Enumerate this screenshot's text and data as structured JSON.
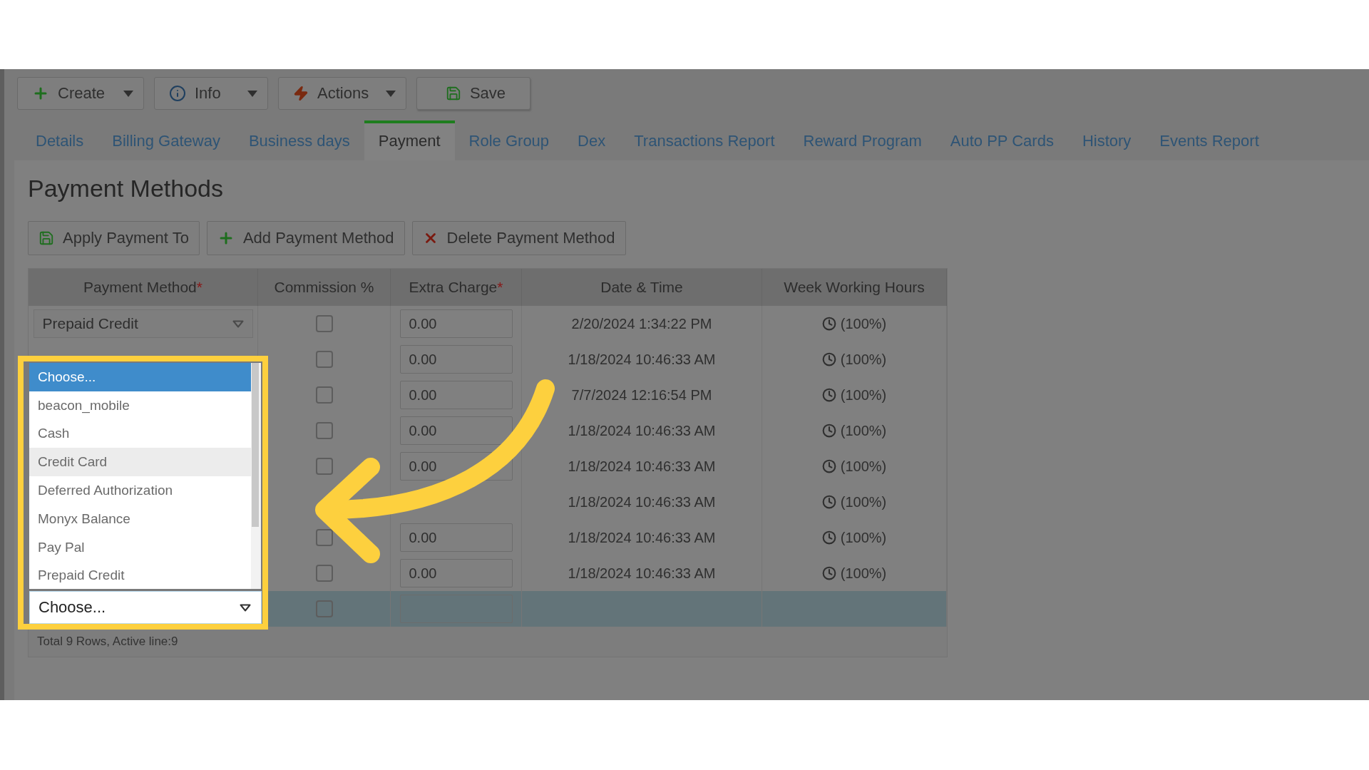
{
  "toolbar": [
    {
      "label": "Create",
      "kind": "create",
      "dropdown": true
    },
    {
      "label": "Info",
      "kind": "info",
      "dropdown": true
    },
    {
      "label": "Actions",
      "kind": "actions",
      "dropdown": true
    },
    {
      "label": "Save",
      "kind": "save",
      "dropdown": false
    }
  ],
  "tabs": [
    {
      "label": "Details",
      "selected": false
    },
    {
      "label": "Billing Gateway",
      "selected": false
    },
    {
      "label": "Business days",
      "selected": false
    },
    {
      "label": "Payment",
      "selected": true
    },
    {
      "label": "Role Group",
      "selected": false
    },
    {
      "label": "Dex",
      "selected": false
    },
    {
      "label": "Transactions Report",
      "selected": false
    },
    {
      "label": "Reward Program",
      "selected": false
    },
    {
      "label": "Auto PP Cards",
      "selected": false
    },
    {
      "label": "History",
      "selected": false
    },
    {
      "label": "Events Report",
      "selected": false
    }
  ],
  "title": "Payment Methods",
  "actions": [
    {
      "label": "Apply Payment To",
      "kind": "save"
    },
    {
      "label": "Add Payment Method",
      "kind": "add"
    },
    {
      "label": "Delete Payment Method",
      "kind": "delete"
    }
  ],
  "table": {
    "columns": [
      {
        "label": "Payment Method",
        "mark": "*"
      },
      {
        "label": "Commission %"
      },
      {
        "label": "Extra Charge",
        "mark": "*"
      },
      {
        "label": "Date & Time"
      },
      {
        "label": "Week Working Hours"
      }
    ],
    "rows": [
      {
        "payment_method": "Prepaid Credit",
        "checked": false,
        "extra_charge": "0.00",
        "date_time": "2/20/2024 1:34:22 PM",
        "week_hours": "(100%)",
        "selected": false
      },
      {
        "checked": false,
        "extra_charge": "0.00",
        "date_time": "1/18/2024 10:46:33 AM",
        "week_hours": "(100%)",
        "selected": false
      },
      {
        "checked": false,
        "extra_charge": "0.00",
        "date_time": "7/7/2024 12:16:54 PM",
        "week_hours": "(100%)",
        "selected": false
      },
      {
        "checked": false,
        "extra_charge": "0.00",
        "date_time": "1/18/2024 10:46:33 AM",
        "week_hours": "(100%)",
        "selected": false
      },
      {
        "checked": false,
        "extra_charge": "0.00",
        "date_time": "1/18/2024 10:46:33 AM",
        "week_hours": "(100%)",
        "selected": false
      },
      {
        "date_time": "1/18/2024 10:46:33 AM",
        "week_hours": "(100%)",
        "selected": false
      },
      {
        "checked": false,
        "extra_charge": "0.00",
        "date_time": "1/18/2024 10:46:33 AM",
        "week_hours": "(100%)",
        "selected": false
      },
      {
        "checked": false,
        "extra_charge": "0.00",
        "date_time": "1/18/2024 10:46:33 AM",
        "week_hours": "(100%)",
        "selected": false
      },
      {
        "checked": false,
        "selected": true
      }
    ],
    "footer": "Total 9 Rows, Active line:9"
  },
  "dropdown": {
    "value": "Choose...",
    "options": [
      {
        "label": "Choose...",
        "selected": true,
        "hovered": false
      },
      {
        "label": "beacon_mobile",
        "selected": false,
        "hovered": false
      },
      {
        "label": "Cash",
        "selected": false,
        "hovered": false
      },
      {
        "label": "Credit Card",
        "selected": false,
        "hovered": true
      },
      {
        "label": "Deferred Authorization",
        "selected": false,
        "hovered": false
      },
      {
        "label": "Monyx Balance",
        "selected": false,
        "hovered": false
      },
      {
        "label": "Pay Pal",
        "selected": false,
        "hovered": false
      },
      {
        "label": "Prepaid Credit",
        "selected": false,
        "hovered": false
      }
    ]
  }
}
